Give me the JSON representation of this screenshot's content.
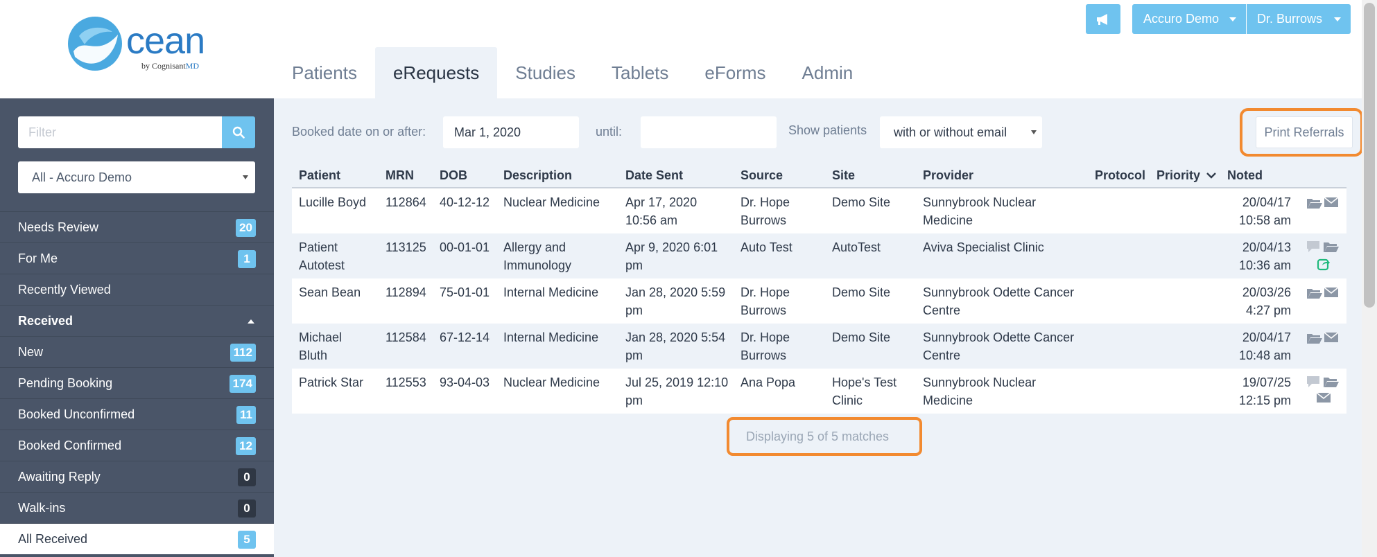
{
  "header": {
    "logo_word": "cean",
    "logo_by": "by Cognisant",
    "logo_md": "MD",
    "nav_tabs": [
      {
        "label": "Patients"
      },
      {
        "label": "eRequests"
      },
      {
        "label": "Studies"
      },
      {
        "label": "Tablets"
      },
      {
        "label": "eForms"
      },
      {
        "label": "Admin"
      }
    ],
    "active_tab": "eRequests",
    "megaphone_icon": "megaphone-icon",
    "clinic_dropdown": "Accuro Demo",
    "user_dropdown": "Dr. Burrows",
    "accent_color": "#6fc3ef"
  },
  "sidebar": {
    "filter_placeholder": "Filter",
    "clinic_select": "All - Accuro Demo",
    "items": [
      {
        "label": "Needs Review",
        "count": "20"
      },
      {
        "label": "For Me",
        "count": "1"
      },
      {
        "label": "Recently Viewed",
        "count": ""
      },
      {
        "label": "Received",
        "count": ""
      },
      {
        "label": "New",
        "count": "112"
      },
      {
        "label": "Pending Booking",
        "count": "174"
      },
      {
        "label": "Booked Unconfirmed",
        "count": "11"
      },
      {
        "label": "Booked Confirmed",
        "count": "12"
      },
      {
        "label": "Awaiting Reply",
        "count": "0"
      },
      {
        "label": "Walk-ins",
        "count": "0"
      },
      {
        "label": "All Received",
        "count": "5"
      }
    ]
  },
  "filters": {
    "booked_label": "Booked date on or after:",
    "booked_value": "Mar 1, 2020",
    "until_label": "until:",
    "until_value": "",
    "show_label": "Show patients",
    "show_value": "with or without email",
    "print_button": "Print Referrals"
  },
  "table": {
    "columns": [
      "Patient",
      "MRN",
      "DOB",
      "Description",
      "Date Sent",
      "Source",
      "Site",
      "Provider",
      "Protocol",
      "Priority",
      "Noted"
    ],
    "rows": [
      {
        "patient": [
          "Lucille Boyd",
          ""
        ],
        "mrn": "112864",
        "dob": "40-12-12",
        "description": [
          "Nuclear Medicine",
          ""
        ],
        "date_sent": [
          "Apr 17, 2020",
          "10:56 am"
        ],
        "source": [
          "Dr. Hope",
          "Burrows"
        ],
        "site": [
          "Demo Site",
          ""
        ],
        "provider": [
          "Sunnybrook Nuclear",
          "Medicine"
        ],
        "protocol": "",
        "priority": "",
        "noted": [
          "20/04/17",
          "10:58 am"
        ],
        "icons": [
          "folder-icon",
          "envelope-icon"
        ]
      },
      {
        "patient": [
          "Patient",
          "Autotest"
        ],
        "mrn": "113125",
        "dob": "00-01-01",
        "description": [
          "Allergy and",
          "Immunology"
        ],
        "date_sent": [
          "Apr 9, 2020 6:01",
          "pm"
        ],
        "source": [
          "Auto Test",
          ""
        ],
        "site": [
          "AutoTest",
          ""
        ],
        "provider": [
          "Aviva Specialist Clinic",
          ""
        ],
        "protocol": "",
        "priority": "",
        "noted": [
          "20/04/13",
          "10:36 am"
        ],
        "icons": [
          "comment-icon",
          "folder-icon",
          "share-icon"
        ]
      },
      {
        "patient": [
          "Sean Bean",
          ""
        ],
        "mrn": "112894",
        "dob": "75-01-01",
        "description": [
          "Internal Medicine",
          ""
        ],
        "date_sent": [
          "Jan 28, 2020 5:59",
          "pm"
        ],
        "source": [
          "Dr. Hope",
          "Burrows"
        ],
        "site": [
          "Demo Site",
          ""
        ],
        "provider": [
          "Sunnybrook Odette Cancer",
          "Centre"
        ],
        "protocol": "",
        "priority": "",
        "noted": [
          "20/03/26",
          "4:27 pm"
        ],
        "icons": [
          "folder-icon",
          "envelope-icon"
        ]
      },
      {
        "patient": [
          "Michael",
          "Bluth"
        ],
        "mrn": "112584",
        "dob": "67-12-14",
        "description": [
          "Internal Medicine",
          ""
        ],
        "date_sent": [
          "Jan 28, 2020 5:54",
          "pm"
        ],
        "source": [
          "Dr. Hope",
          "Burrows"
        ],
        "site": [
          "Demo Site",
          ""
        ],
        "provider": [
          "Sunnybrook Odette Cancer",
          "Centre"
        ],
        "protocol": "",
        "priority": "",
        "noted": [
          "20/04/17",
          "10:48 am"
        ],
        "icons": [
          "folder-icon",
          "envelope-icon"
        ]
      },
      {
        "patient": [
          "Patrick Star",
          ""
        ],
        "mrn": "112553",
        "dob": "93-04-03",
        "description": [
          "Nuclear Medicine",
          ""
        ],
        "date_sent": [
          "Jul 25, 2019 12:10",
          "pm"
        ],
        "source": [
          "Ana Popa",
          ""
        ],
        "site": [
          "Hope's Test",
          "Clinic"
        ],
        "provider": [
          "Sunnybrook Nuclear",
          "Medicine"
        ],
        "protocol": "",
        "priority": "",
        "noted": [
          "19/07/25",
          "12:15 pm"
        ],
        "icons": [
          "comment-icon",
          "folder-icon",
          "envelope-icon"
        ]
      }
    ],
    "match_text": "Displaying 5 of 5 matches"
  },
  "colors": {
    "sidebar_bg": "#4a5568",
    "main_bg": "#edf2f8",
    "highlight": "#f28a30",
    "share_icon": "#1fb97c"
  }
}
